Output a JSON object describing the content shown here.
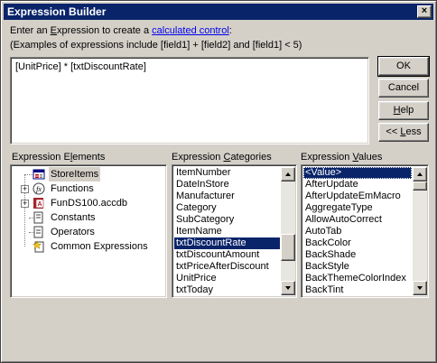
{
  "window": {
    "title": "Expression Builder",
    "close_glyph": "×"
  },
  "prompt": {
    "line1_before": "Enter an ",
    "line1_ak": "E",
    "line1_mid": "xpression to create a ",
    "line1_link": "calculated control",
    "line1_after": ":",
    "line2": "(Examples of expressions include [field1] + [field2] and [field1] < 5)"
  },
  "expression": {
    "value": "[UnitPrice] * [txtDiscountRate]"
  },
  "buttons": {
    "ok": "OK",
    "cancel": "Cancel",
    "help_ak": "H",
    "help_rest": "elp",
    "less_pre": "<< ",
    "less_ak": "L",
    "less_rest": "ess"
  },
  "panes": {
    "elements": {
      "label_pre": "Expression E",
      "label_ak": "l",
      "label_rest": "ements",
      "items": [
        {
          "label": "StoreItems",
          "icon": "form-icon",
          "selected": true
        },
        {
          "label": "Functions",
          "icon": "function-icon"
        },
        {
          "label": "FunDS100.accdb",
          "icon": "database-icon"
        },
        {
          "label": "Constants",
          "icon": "constants-icon"
        },
        {
          "label": "Operators",
          "icon": "operators-icon"
        },
        {
          "label": "Common Expressions",
          "icon": "common-expressions-icon"
        }
      ]
    },
    "categories": {
      "label_pre": "Expression ",
      "label_ak": "C",
      "label_rest": "ategories",
      "items": [
        "ItemNumber",
        "DateInStore",
        "Manufacturer",
        "Category",
        "SubCategory",
        "ItemName",
        "txtDiscountRate",
        "txtDiscountAmount",
        "txtPriceAfterDiscount",
        "UnitPrice",
        "txtToday"
      ],
      "selected_index": 6
    },
    "values": {
      "label_pre": "Expression ",
      "label_ak": "V",
      "label_rest": "alues",
      "items": [
        "<Value>",
        "AfterUpdate",
        "AfterUpdateEmMacro",
        "AggregateType",
        "AllowAutoCorrect",
        "AutoTab",
        "BackColor",
        "BackShade",
        "BackStyle",
        "BackThemeColorIndex",
        "BackTint"
      ],
      "selected_index": 0
    }
  },
  "colors": {
    "title_bar": "#0a246a",
    "face": "#d4d0c8",
    "selection": "#0a246a",
    "link": "#0000ee"
  }
}
